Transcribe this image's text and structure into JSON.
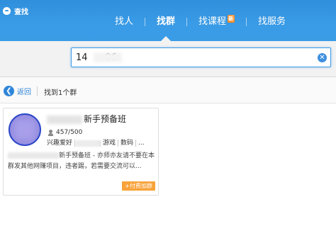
{
  "app": {
    "title": "查找",
    "logo_icon": "qq-penguin-icon"
  },
  "nav": {
    "tabs": [
      {
        "label": "找人",
        "active": false
      },
      {
        "label": "找群",
        "active": true
      },
      {
        "label": "找课程",
        "active": false,
        "badge": "新"
      },
      {
        "label": "找服务",
        "active": false
      }
    ]
  },
  "search": {
    "value": "14      96",
    "clear_icon": "clear-icon"
  },
  "toolbar": {
    "back_label": "返回",
    "result_count": "找到1个群"
  },
  "result": {
    "name": "新手预备班",
    "members": "457/500",
    "tags": [
      "兴趣爱好",
      "",
      "游戏",
      "数码",
      "..."
    ],
    "description": "新手预备班 - 亦师亦友请不要在本群发其他网赚项目，违者踢，若需要交流可以...",
    "join_label": "+付费加群"
  },
  "colors": {
    "header": "#3a9be6",
    "accent": "#2e86d9",
    "join": "#f8a23a",
    "badge": "#ff8a1c"
  }
}
